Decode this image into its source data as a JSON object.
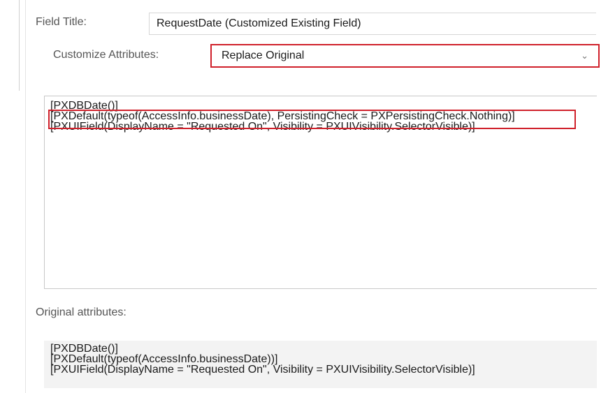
{
  "field_title": {
    "label": "Field Title:",
    "value": "RequestDate (Customized Existing Field)"
  },
  "customize_attributes": {
    "label": "Customize Attributes:",
    "selected": "Replace Original",
    "dropdown_icon": "chevron-down-icon"
  },
  "custom_attributes": {
    "lines": [
      "[PXDBDate()]",
      "[PXDefault(typeof(AccessInfo.businessDate), PersistingCheck = PXPersistingCheck.Nothing)]",
      "[PXUIField(DisplayName = \"Requested On\", Visibility = PXUIVisibility.SelectorVisible)]"
    ]
  },
  "original_attributes": {
    "label": "Original attributes:",
    "lines": [
      "[PXDBDate()]",
      "[PXDefault(typeof(AccessInfo.businessDate))]",
      "[PXUIField(DisplayName = \"Requested On\", Visibility = PXUIVisibility.SelectorVisible)]"
    ]
  },
  "colors": {
    "highlight": "#d0202a",
    "readonly_background": "#f3f3f3"
  }
}
